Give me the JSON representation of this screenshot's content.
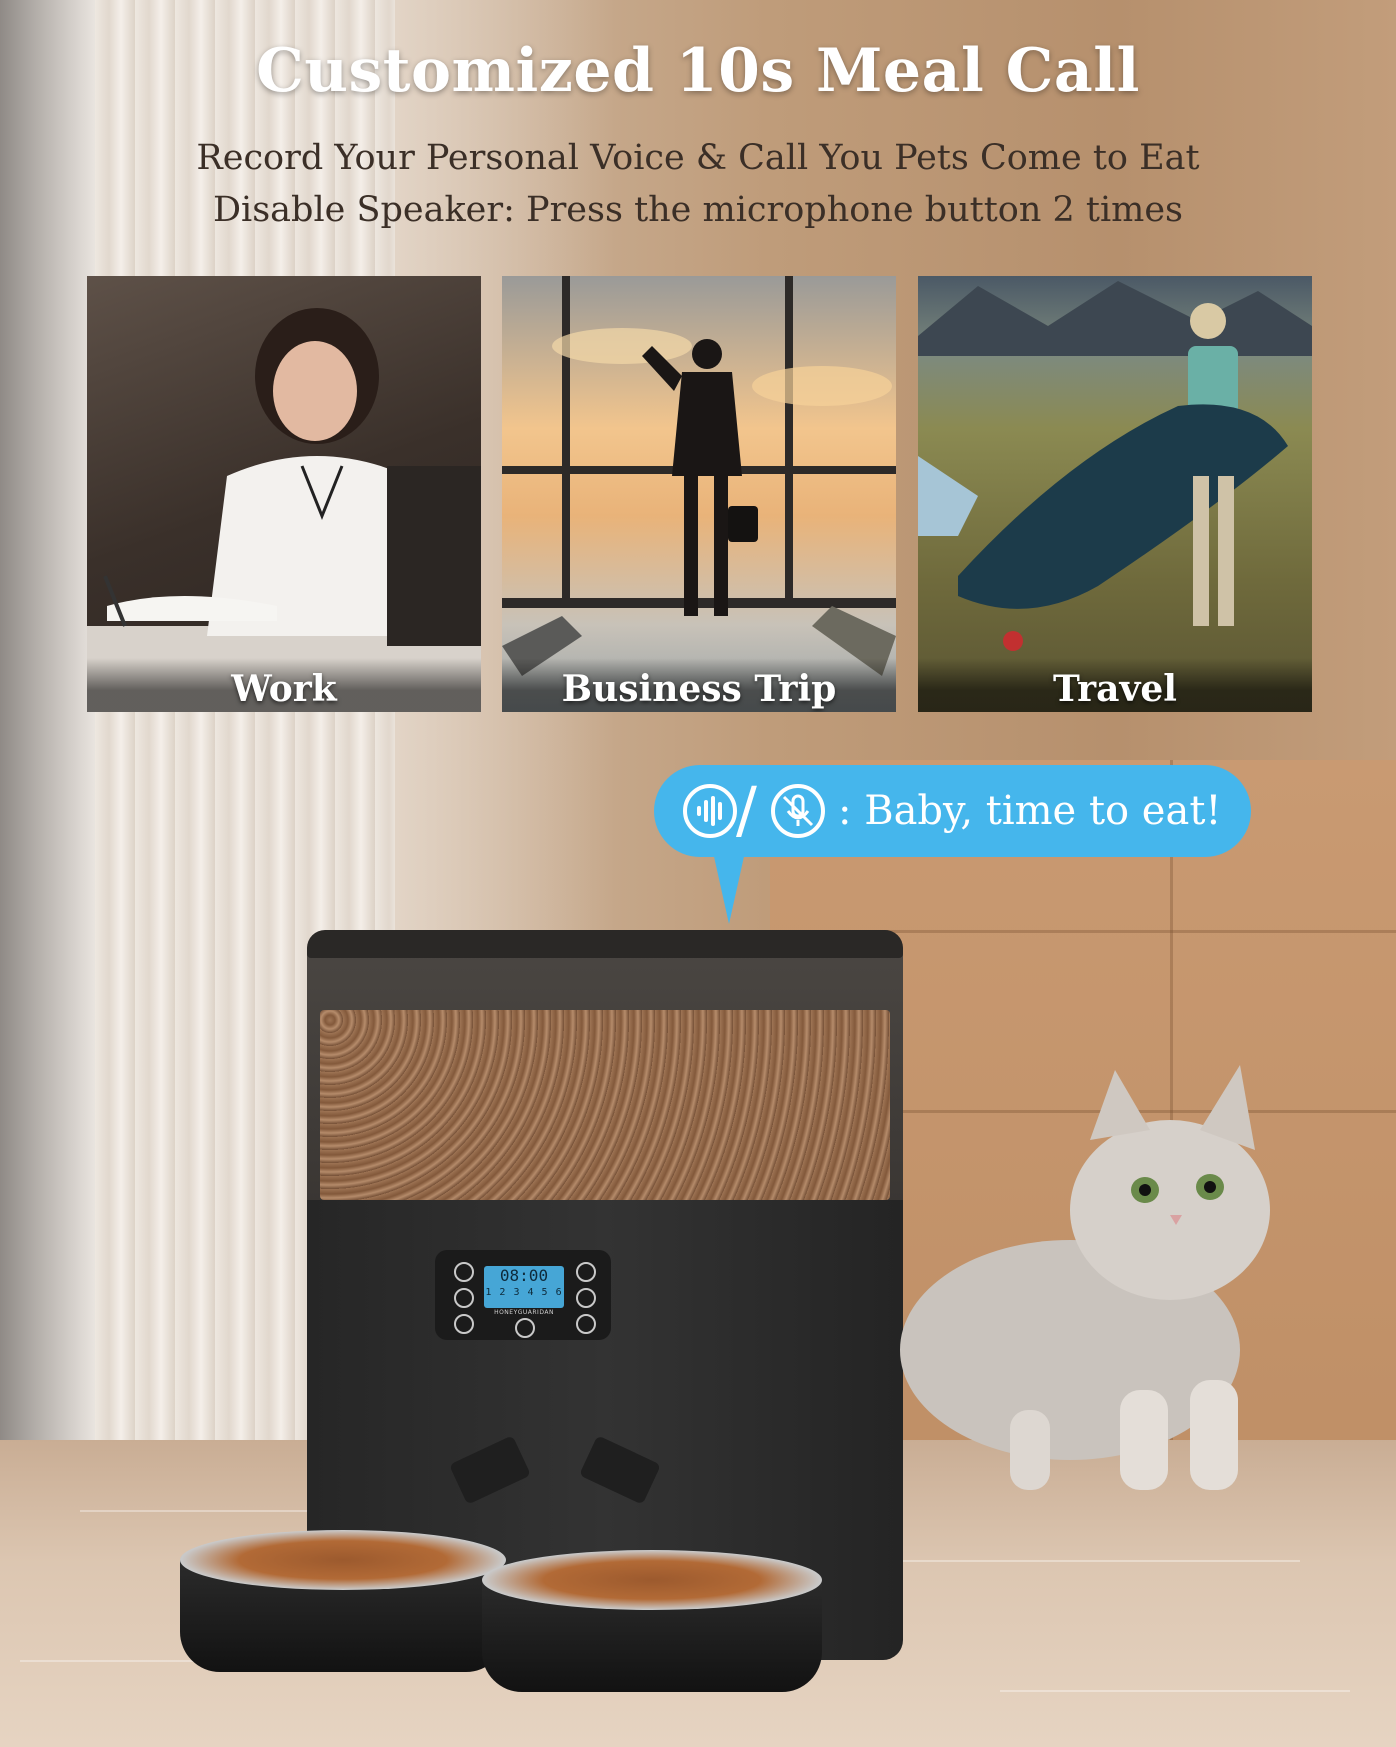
{
  "headline": "Customized 10s Meal Call",
  "subheadline_1": "Record Your Personal Voice & Call You Pets Come to Eat",
  "subheadline_2": "Disable Speaker: Press the microphone button 2 times",
  "scenarios": [
    {
      "label": "Work"
    },
    {
      "label": "Business Trip"
    },
    {
      "label": "Travel"
    }
  ],
  "speech_bubble": {
    "text": ": Baby, time to eat!",
    "icons": [
      "voice-wave-icon",
      "mute-microphone-icon"
    ],
    "color": "#45b6ec"
  },
  "feeder_display": {
    "time": "08:00",
    "slots": "1 2 3 4 5 6",
    "brand": "HONEYGUARIDAN",
    "lcd_color": "#46a6d6"
  },
  "colors": {
    "headline": "#ffffff",
    "subheadline": "#3b2f27",
    "feeder_body": "#2b2b2b"
  }
}
